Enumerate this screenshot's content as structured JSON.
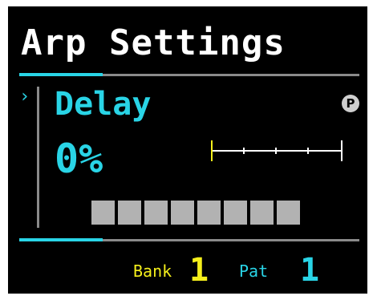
{
  "screen": {
    "title": "Arp Settings",
    "parameter": {
      "name": "Delay",
      "value": "0%",
      "indicator_icon": "p-circle-icon",
      "indicator_text": "P",
      "selection_glyph": "›",
      "level_fraction": 0.0
    },
    "steps": {
      "count": 8,
      "active": 0
    },
    "footer": {
      "bank_label": "Bank",
      "bank_value": "1",
      "pattern_label": "Pat",
      "pattern_value": "1"
    }
  },
  "colors": {
    "accent_cyan": "#29d4e6",
    "accent_yellow": "#f5ef1b",
    "divider_gray": "#8a8a8a",
    "step_gray": "#b2b2b2",
    "background": "#000000",
    "text": "#ffffff"
  }
}
